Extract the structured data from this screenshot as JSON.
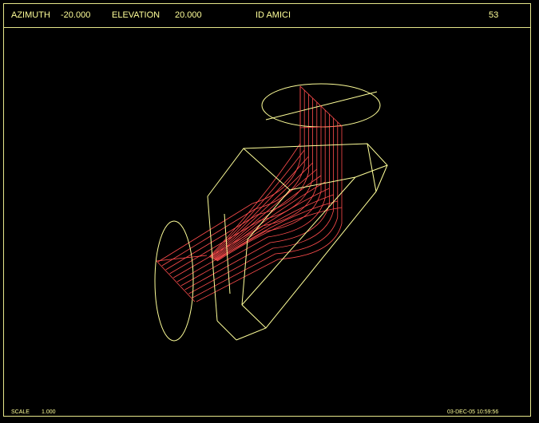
{
  "header": {
    "azimuth_label": "AZIMUTH",
    "azimuth_value": "-20.000",
    "elevation_label": "ELEVATION",
    "elevation_value": "20.000",
    "title": "ID AMICI",
    "number": "53"
  },
  "footer": {
    "scale_label": "SCALE",
    "scale_value": "1.000",
    "timestamp": "03-DEC-05  10:59:56"
  },
  "colors": {
    "outline": "#ffff99",
    "rays": "#ff4d4d",
    "background": "#000000"
  }
}
